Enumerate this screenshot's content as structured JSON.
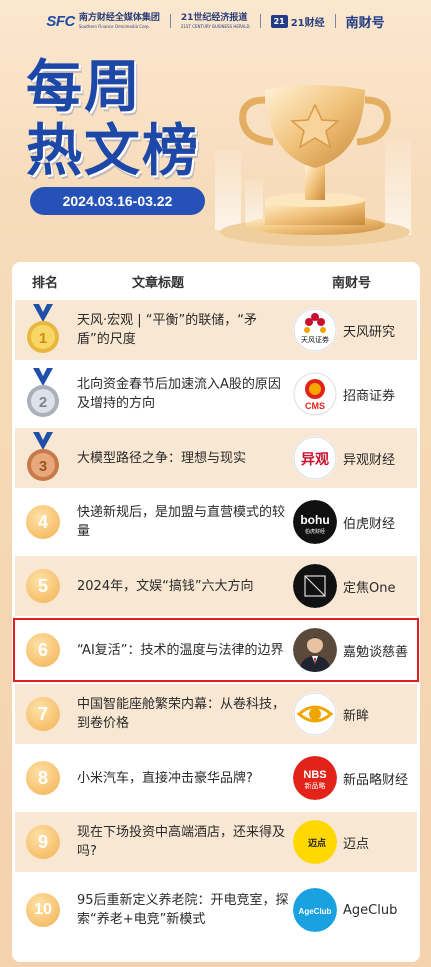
{
  "header": {
    "brands": {
      "sfc_logo": "SFC",
      "sfc_name": "南方财经全媒体集团",
      "sfc_en": "Southern Finance Omnimedia Corp.",
      "b21_name": "21世纪经济报道",
      "b21_en": "21ST CENTURY BUSINESS HERALD",
      "cj21_badge": "21",
      "cj21_name": "21财经",
      "ncf_name": "南财号"
    },
    "title_line1": "每周",
    "title_line2": "热文榜",
    "date_range": "2024.03.16-03.22"
  },
  "table": {
    "col_rank": "排名",
    "col_title": "文章标题",
    "col_account": "南财号",
    "rows": [
      {
        "rank": "1",
        "title": "天风·宏观 | “平衡”的联储，“矛盾”的尺度",
        "account": "天风研究",
        "logo_text": "天风证券",
        "logo_icon": "tianfeng-logo-icon"
      },
      {
        "rank": "2",
        "title": "北向资金春节后加速流入A股的原因及增持的方向",
        "account": "招商证券",
        "logo_text": "CMS",
        "logo_icon": "cms-logo-icon"
      },
      {
        "rank": "3",
        "title": "大模型路径之争：理想与现实",
        "account": "异观财经",
        "logo_text": "异观",
        "logo_icon": "yiguan-logo-icon"
      },
      {
        "rank": "4",
        "title": "快递新规后，是加盟与直营模式的较量",
        "account": "伯虎财经",
        "logo_text": "bohu",
        "logo_sub": "伯虎财经",
        "logo_icon": "bohu-logo-icon"
      },
      {
        "rank": "5",
        "title": "2024年，文娱“搞钱”六大方向",
        "account": "定焦One",
        "logo_text": "",
        "logo_icon": "dingjiao-logo-icon"
      },
      {
        "rank": "6",
        "title": "“AI复活”：技术的温度与法律的边界",
        "account": "嘉勉谈慈善",
        "logo_text": "",
        "logo_icon": "avatar-photo-icon"
      },
      {
        "rank": "7",
        "title": "中国智能座舱繁荣内幕：从卷科技，到卷价格",
        "account": "新眸",
        "logo_text": "",
        "logo_icon": "eye-logo-icon"
      },
      {
        "rank": "8",
        "title": "小米汽车，直接冲击豪华品牌?",
        "account": "新品略财经",
        "logo_text": "NBS",
        "logo_sub": "新品略",
        "logo_icon": "nbs-logo-icon"
      },
      {
        "rank": "9",
        "title": "现在下场投资中高端酒店，还来得及吗?",
        "account": "迈点",
        "logo_text": "迈点",
        "logo_icon": "maidian-logo-icon"
      },
      {
        "rank": "10",
        "title": "95后重新定义养老院：开电竞室，探索“养老+电竞”新模式",
        "account": "AgeClub",
        "logo_text": "AgeClub",
        "logo_icon": "ageclub-logo-icon"
      }
    ]
  },
  "colors": {
    "brand_blue": "#1e48a8",
    "highlight_red": "#e11e1e",
    "row_stripe": "#f8e7d2",
    "rank_orange": "#f6bf6c"
  }
}
